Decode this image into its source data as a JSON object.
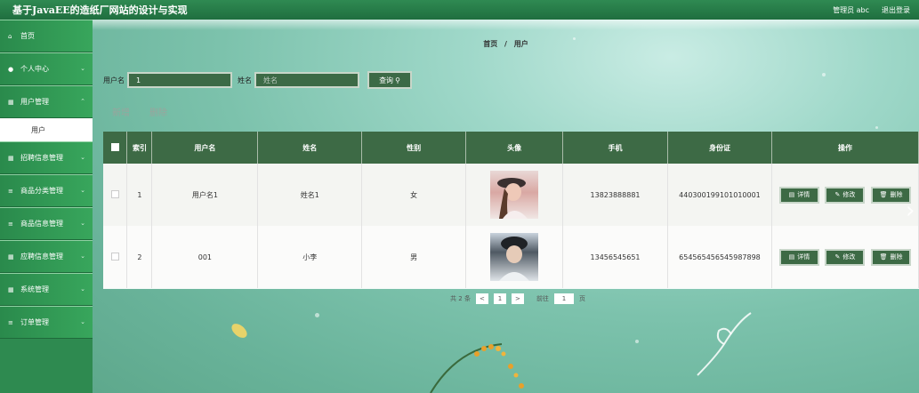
{
  "header": {
    "app_title": "基于JavaEE的造纸厂网站的设计与实现",
    "admin_label": "管理员 abc",
    "logout_label": "退出登录"
  },
  "sidebar": {
    "items": [
      {
        "label": "首页",
        "icon": "home-icon"
      },
      {
        "label": "个人中心",
        "icon": "user-icon"
      },
      {
        "label": "用户管理",
        "icon": "grid-icon"
      },
      {
        "label": "招聘信息管理",
        "icon": "grid-icon"
      },
      {
        "label": "商品分类管理",
        "icon": "list-icon"
      },
      {
        "label": "商品信息管理",
        "icon": "list-icon"
      },
      {
        "label": "应聘信息管理",
        "icon": "grid-icon"
      },
      {
        "label": "系统管理",
        "icon": "grid-icon"
      },
      {
        "label": "订单管理",
        "icon": "list-icon"
      }
    ],
    "active_sub": "用户"
  },
  "breadcrumb": {
    "home": "首页",
    "separator": "/",
    "current": "用户"
  },
  "search": {
    "username_label": "用户名",
    "username_value": "1",
    "name_label": "姓名",
    "name_placeholder": "姓名",
    "search_button": "查询"
  },
  "actions": {
    "add": "新增",
    "delete": "删除"
  },
  "table": {
    "headers": [
      "索引",
      "用户名",
      "姓名",
      "性别",
      "头像",
      "手机",
      "身份证",
      "操作"
    ],
    "rows": [
      {
        "index": "1",
        "username": "用户名1",
        "name": "姓名1",
        "gender": "女",
        "phone": "13823888881",
        "id_card": "440300199101010001"
      },
      {
        "index": "2",
        "username": "001",
        "name": "小李",
        "gender": "男",
        "phone": "13456545651",
        "id_card": "654565456545987898"
      }
    ],
    "row_actions": {
      "detail": "详情",
      "edit": "修改",
      "delete": "删除"
    }
  },
  "pagination": {
    "total_prefix": "共",
    "total_count": "2",
    "total_suffix": "条",
    "prev": "<",
    "current_page": "1",
    "next": ">",
    "goto_label": "前往",
    "goto_value": "1",
    "page_suffix": "页"
  },
  "colors": {
    "primary_green": "#3d6a45",
    "sidebar_green": "#2e8a50",
    "topbar_green": "#1f6e3f"
  }
}
